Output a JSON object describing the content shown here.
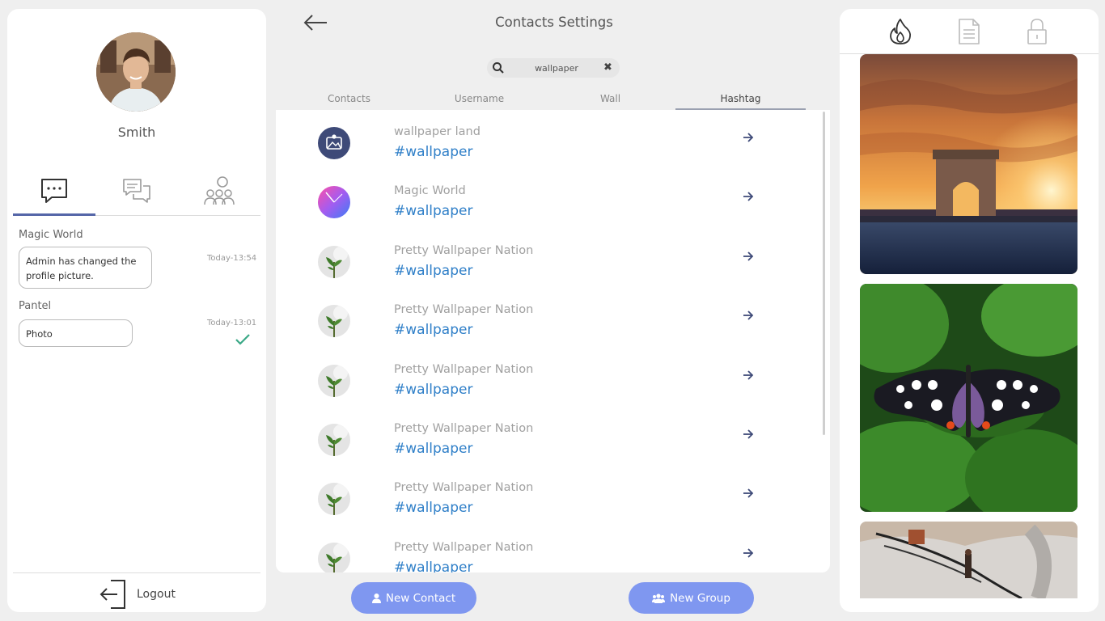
{
  "profile": {
    "name": "Smith"
  },
  "left_tabs": [
    "chat",
    "messages",
    "groups"
  ],
  "messages": [
    {
      "sender": "Magic World",
      "text": "Admin has changed the profile picture.",
      "time": "Today-13:54"
    },
    {
      "sender": "Pantel",
      "text": "Photo",
      "time": "Today-13:01"
    }
  ],
  "logout_label": "Logout",
  "header": {
    "title": "Contacts Settings"
  },
  "search": {
    "value": "wallpaper"
  },
  "tabs": [
    "Contacts",
    "Username",
    "Wall",
    "Hashtag"
  ],
  "active_tab": "Hashtag",
  "results": [
    {
      "name": "wallpaper land",
      "tag": "#wallpaper"
    },
    {
      "name": "Magic World",
      "tag": "#wallpaper"
    },
    {
      "name": "Pretty Wallpaper Nation",
      "tag": "#wallpaper"
    },
    {
      "name": "Pretty Wallpaper Nation",
      "tag": "#wallpaper"
    },
    {
      "name": "Pretty Wallpaper Nation",
      "tag": "#wallpaper"
    },
    {
      "name": "Pretty Wallpaper Nation",
      "tag": "#wallpaper"
    },
    {
      "name": "Pretty Wallpaper Nation",
      "tag": "#wallpaper"
    },
    {
      "name": "Pretty Wallpaper Nation",
      "tag": "#wallpaper"
    }
  ],
  "buttons": {
    "new_contact": "New Contact",
    "new_group": "New Group"
  },
  "colors": {
    "accent": "#7f97f0",
    "hashtag": "#2f7fc8",
    "active_tab": "#5566a8",
    "check": "#3aa886"
  },
  "right_tabs": [
    "fire-icon",
    "document-icon",
    "lock-icon"
  ]
}
